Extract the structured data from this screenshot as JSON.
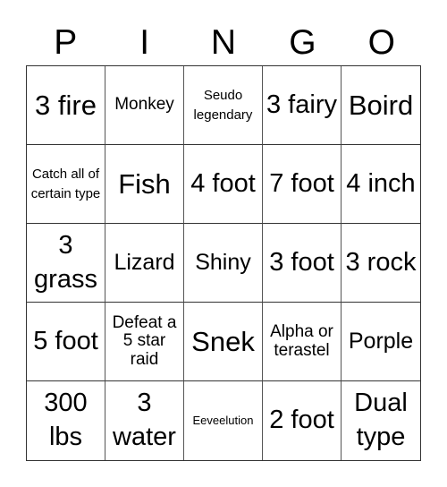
{
  "header": {
    "letters": [
      "P",
      "I",
      "N",
      "G",
      "O"
    ]
  },
  "cells": [
    {
      "text": "3 fire",
      "size": "s-xl"
    },
    {
      "text": "Monkey",
      "size": "s-sm"
    },
    {
      "text": "Seudo legendary",
      "size": "s-xs"
    },
    {
      "text": "3 fairy",
      "size": "s-lg"
    },
    {
      "text": "Boird",
      "size": "s-xl"
    },
    {
      "text": "Catch all of certain type",
      "size": "s-xs"
    },
    {
      "text": "Fish",
      "size": "s-xl"
    },
    {
      "text": "4 foot",
      "size": "s-lg"
    },
    {
      "text": "7 foot",
      "size": "s-lg"
    },
    {
      "text": "4 inch",
      "size": "s-lg"
    },
    {
      "text": "3 grass",
      "size": "s-lg"
    },
    {
      "text": "Lizard",
      "size": "s-md"
    },
    {
      "text": "Shiny",
      "size": "s-md"
    },
    {
      "text": "3 foot",
      "size": "s-lg"
    },
    {
      "text": "3 rock",
      "size": "s-lg"
    },
    {
      "text": "5 foot",
      "size": "s-lg"
    },
    {
      "text": "Defeat a 5 star raid",
      "size": "s-sm"
    },
    {
      "text": "Snek",
      "size": "s-xl"
    },
    {
      "text": "Alpha or terastel",
      "size": "s-sm"
    },
    {
      "text": "Porple",
      "size": "s-md"
    },
    {
      "text": "300 lbs",
      "size": "s-lg"
    },
    {
      "text": "3 water",
      "size": "s-lg"
    },
    {
      "text": "Eeveelution",
      "size": "s-xxs"
    },
    {
      "text": "2 foot",
      "size": "s-lg"
    },
    {
      "text": "Dual type",
      "size": "s-lg"
    }
  ]
}
